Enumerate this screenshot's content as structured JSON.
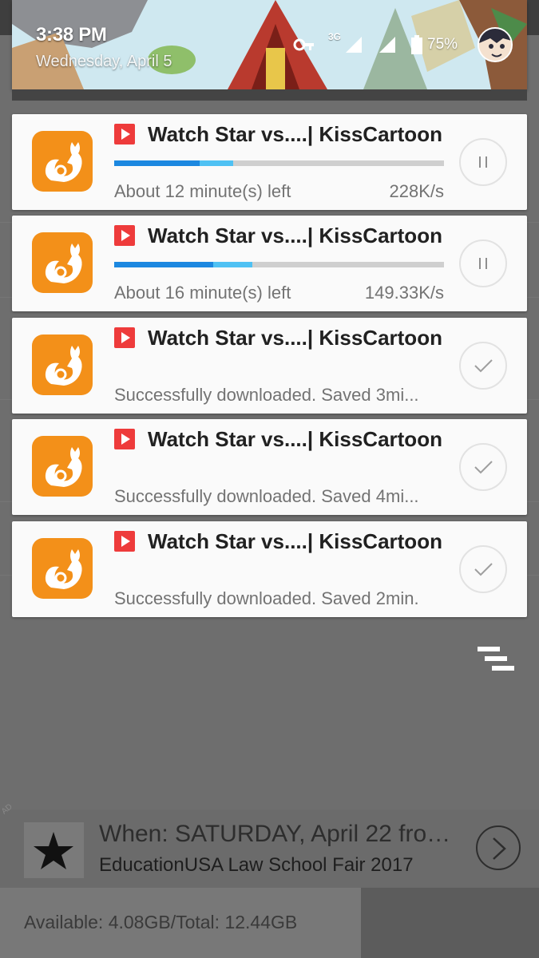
{
  "status_bar": {
    "time": "3:38 PM",
    "date": "Wednesday, April 5",
    "network_type": "3G",
    "battery": "75%"
  },
  "notifications": [
    {
      "title": "Watch Star vs....| KissCartoon",
      "state": "downloading",
      "progress": 0.26,
      "buffered": 0.36,
      "time_left": "About 12 minute(s) left",
      "speed": "228K/s"
    },
    {
      "title": "Watch Star vs....| KissCartoon",
      "state": "downloading",
      "progress": 0.3,
      "buffered": 0.42,
      "time_left": "About 16 minute(s) left",
      "speed": "149.33K/s"
    },
    {
      "title": "Watch Star vs....| KissCartoon",
      "state": "done",
      "message": "Successfully downloaded. Saved 3mi..."
    },
    {
      "title": "Watch Star vs....| KissCartoon",
      "state": "done",
      "message": "Successfully downloaded. Saved 4mi..."
    },
    {
      "title": "Watch Star vs....| KissCartoon",
      "state": "done",
      "message": "Successfully downloaded. Saved 2min."
    }
  ],
  "ad": {
    "corner_label": "AD",
    "title": "When: SATURDAY, April 22 from...",
    "subtitle": "EducationUSA Law School Fair 2017"
  },
  "storage": {
    "text": "Available: 4.08GB/Total: 12.44GB",
    "used_fraction": 0.67
  },
  "colors": {
    "app_icon": "#f39019",
    "progress": "#1c88e0",
    "buffer": "#4fc1f3",
    "video_badge": "#ee3b3b"
  },
  "icons": {
    "app": "uc-browser-squirrel-icon",
    "pause": "pause-icon",
    "done": "checkmark-icon",
    "list_toggle": "collapse-list-icon",
    "ad_arrow": "chevron-right-icon"
  }
}
